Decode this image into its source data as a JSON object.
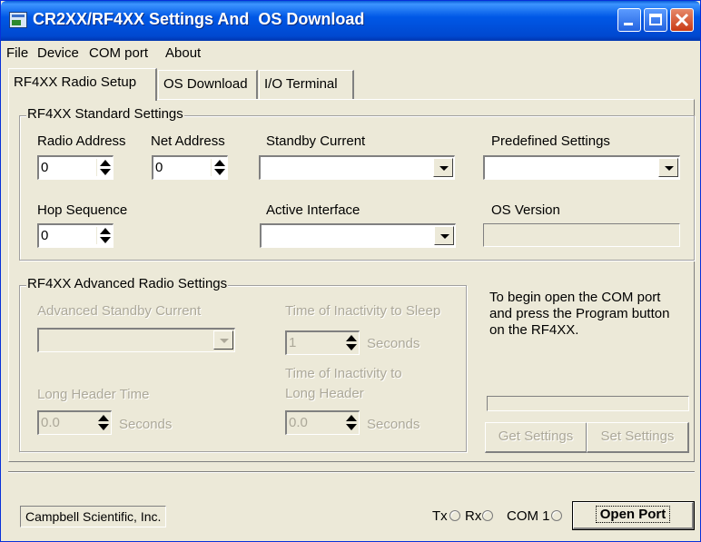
{
  "window": {
    "title": "CR2XX/RF4XX Settings And  OS Download",
    "controls": [
      "minimize-icon",
      "maximize-icon",
      "close-icon"
    ]
  },
  "menubar": {
    "file": "File",
    "device": "Device",
    "com_port": "COM port",
    "about": "About"
  },
  "tabs": [
    {
      "label": "RF4XX Radio Setup",
      "active": true
    },
    {
      "label": "OS Download",
      "active": false
    },
    {
      "label": "I/O Terminal",
      "active": false
    }
  ],
  "standard": {
    "legend": "RF4XX Standard Settings",
    "radio_address": {
      "label": "Radio Address",
      "value": "0"
    },
    "net_address": {
      "label": "Net Address",
      "value": "0"
    },
    "standby_current": {
      "label": "Standby Current",
      "value": ""
    },
    "predefined_settings": {
      "label": "Predefined Settings",
      "value": ""
    },
    "hop_sequence": {
      "label": "Hop Sequence",
      "value": "0"
    },
    "active_interface": {
      "label": "Active Interface",
      "value": ""
    },
    "os_version": {
      "label": "OS Version",
      "value": ""
    }
  },
  "advanced": {
    "legend": "RF4XX Advanced Radio Settings",
    "adv_standby_current": {
      "label": "Advanced Standby Current",
      "value": ""
    },
    "time_to_sleep": {
      "label": "Time of Inactivity to Sleep",
      "value": "1",
      "unit": "Seconds"
    },
    "long_header_time": {
      "label": "Long Header Time",
      "value": "0.0",
      "unit": "Seconds"
    },
    "time_to_long_header": {
      "label_line1": "Time of Inactivity to",
      "label_line2": "Long Header",
      "value": "0.0",
      "unit": "Seconds"
    }
  },
  "instructions": {
    "line1": "To begin open the COM port",
    "line2": "and press the Program button",
    "line3": "on the RF4XX."
  },
  "progress": {
    "value": 0
  },
  "buttons": {
    "get_settings": "Get Settings",
    "set_settings": "Set Settings",
    "open_port": "Open Port"
  },
  "statusbar": {
    "company": "Campbell Scientific, Inc.",
    "tx": "Tx",
    "rx": "Rx",
    "com": "COM 1"
  },
  "colors": {
    "titlebar": "#0058e6",
    "face": "#ece9d8",
    "disabled_text": "#aca899"
  }
}
